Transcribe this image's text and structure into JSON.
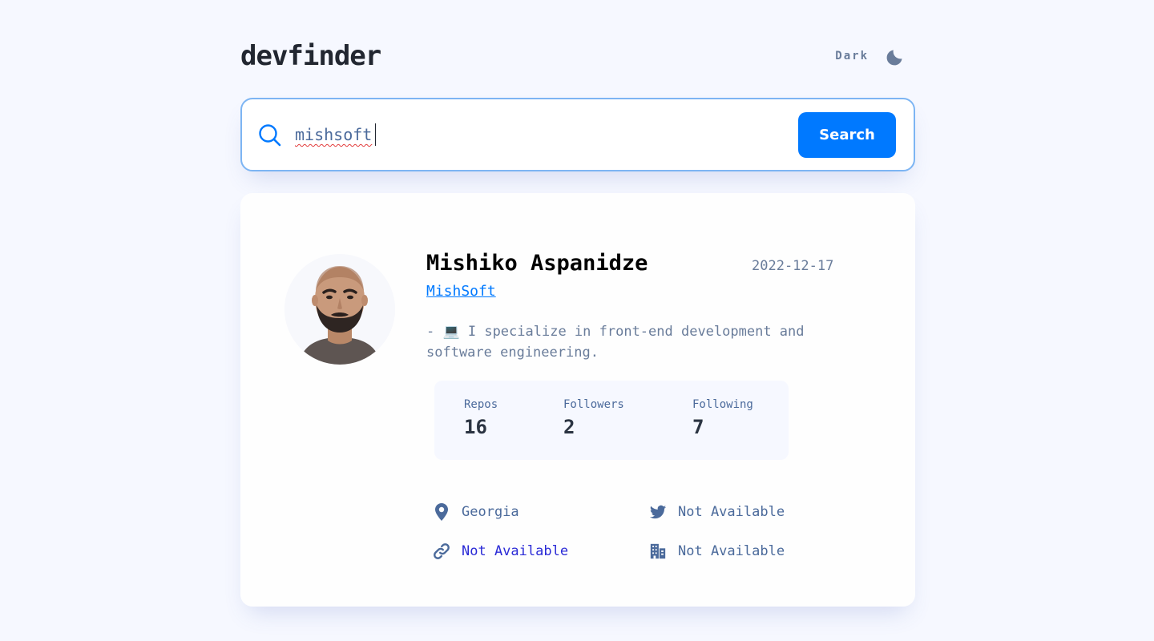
{
  "app": {
    "logo": "devfinder",
    "theme_label": "Dark"
  },
  "search": {
    "value": "mishsoft",
    "placeholder": "",
    "button_label": "Search"
  },
  "profile": {
    "name": "Mishiko Aspanidze",
    "joined": "2022-12-17",
    "username": "MishSoft",
    "bio": "- 💻 I specialize in front-end development and software engineering."
  },
  "stats": {
    "repos_label": "Repos",
    "repos_value": "16",
    "followers_label": "Followers",
    "followers_value": "2",
    "following_label": "Following",
    "following_value": "7"
  },
  "links": {
    "location": "Georgia",
    "twitter": "Not Available",
    "blog": "Not Available",
    "company": "Not Available"
  },
  "colors": {
    "background": "#F6F8FF",
    "card": "#FEFEFE",
    "accent": "#0079FF",
    "muted": "#697C9A",
    "text_dark": "#222731",
    "blog_link": "#2A2AD6"
  },
  "icons": [
    "moon-icon",
    "search-icon",
    "location-icon",
    "twitter-icon",
    "link-icon",
    "company-icon"
  ]
}
